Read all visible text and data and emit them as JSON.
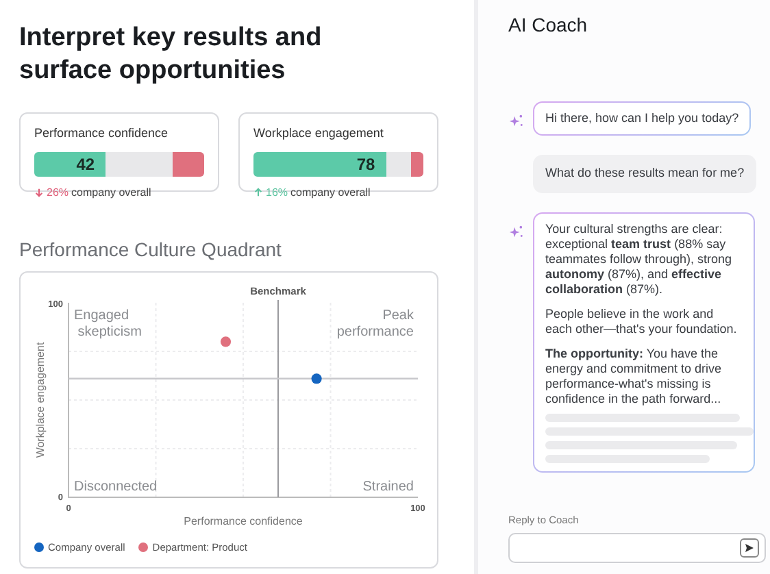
{
  "title": "Interpret key results and surface opportunities",
  "metrics": [
    {
      "label": "Performance confidence",
      "value": "42",
      "level": 0.42,
      "delta": {
        "kind": "down",
        "value": "26%",
        "text": "company overall"
      }
    },
    {
      "label": "Workplace engagement",
      "value": "78",
      "level": 0.78,
      "delta": {
        "kind": "up",
        "value": "16%",
        "text": "company overall"
      }
    }
  ],
  "quadrant": {
    "heading": "Performance Culture Quadrant",
    "quadrant_labels": [
      "Engaged skepticism",
      "Peak performance",
      "Disconnected",
      "Strained"
    ],
    "benchmark_label": "Benchmark",
    "chart_data": {
      "type": "scatter",
      "xlabel": "Performance confidence",
      "ylabel": "Workplace engagement",
      "xlim": [
        0,
        100
      ],
      "ylim": [
        0,
        100
      ],
      "xticks": [
        0,
        100
      ],
      "yticks": [
        0,
        100
      ],
      "ref_lines": [
        {
          "axis": "x",
          "value": 60
        },
        {
          "axis": "y",
          "value": 61
        }
      ],
      "series": [
        {
          "name": "Company overall",
          "color": "#1565c0",
          "x": [
            71
          ],
          "values": [
            61
          ]
        },
        {
          "name": "Department: Product",
          "color": "#e0707e",
          "x": [
            45
          ],
          "values": [
            80
          ]
        }
      ]
    }
  },
  "coach": {
    "title": "AI Coach",
    "messages": [
      {
        "kind": "bot",
        "paragraphs": [
          "Hi there, how can I help you today?"
        ],
        "pending": false
      },
      {
        "kind": "user",
        "paragraphs": [
          "What do these results mean for me?"
        ],
        "pending": false
      },
      {
        "kind": "bot",
        "paragraphs": [
          "Your cultural strengths are clear: exceptional **team trust** (88% say teammates follow through), strong **autonomy** (87%), and **effective collaboration** (87%).",
          "People believe in the work and each other—that's your foundation.",
          "**The opportunity:** You have the energy and commitment to drive performance-what's missing is confidence in the path forward..."
        ],
        "pending": true
      }
    ],
    "reply_label": "Reply to Coach"
  }
}
